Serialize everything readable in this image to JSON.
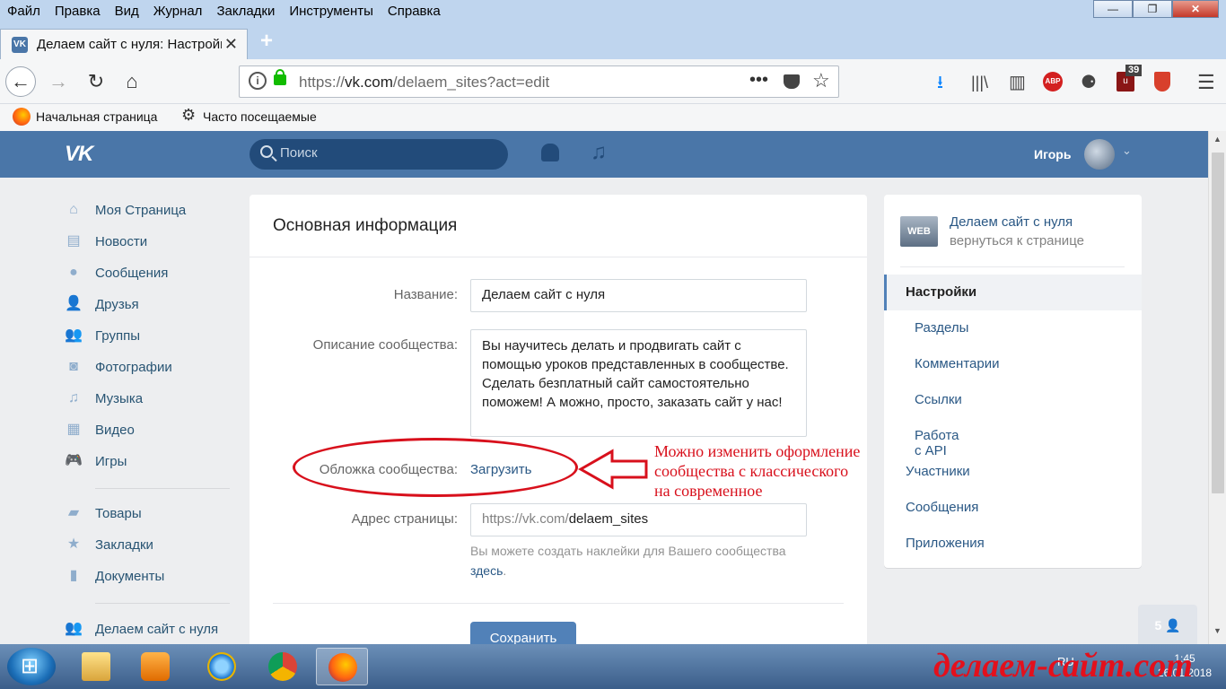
{
  "browser": {
    "menu": [
      "Файл",
      "Правка",
      "Вид",
      "Журнал",
      "Закладки",
      "Инструменты",
      "Справка"
    ],
    "window_buttons": {
      "minimize": "—",
      "maximize": "❐",
      "close": "✕"
    },
    "tab": {
      "title": "Делаем сайт с нуля: Настройки",
      "favicon": "vk-icon",
      "close": "✕"
    },
    "new_tab": "+",
    "url_prefix": "https://",
    "url_domain": "vk.com",
    "url_path": "/delaem_sites?act=edit",
    "page_actions": "•••",
    "ublock_count": "39",
    "abp_label": "ABP",
    "bookmarks": [
      "Начальная страница",
      "Часто посещаемые"
    ]
  },
  "vk_header": {
    "logo": "VK",
    "search_placeholder": "Поиск",
    "user_name": "Игорь"
  },
  "left_nav": [
    {
      "label": "Моя Страница",
      "icon": "home-icon"
    },
    {
      "label": "Новости",
      "icon": "news-icon"
    },
    {
      "label": "Сообщения",
      "icon": "messages-icon"
    },
    {
      "label": "Друзья",
      "icon": "friends-icon"
    },
    {
      "label": "Группы",
      "icon": "groups-icon"
    },
    {
      "label": "Фотографии",
      "icon": "photo-icon"
    },
    {
      "label": "Музыка",
      "icon": "music-icon"
    },
    {
      "label": "Видео",
      "icon": "video-icon"
    },
    {
      "label": "Игры",
      "icon": "games-icon"
    },
    {
      "label": "Товары",
      "icon": "bag-icon"
    },
    {
      "label": "Закладки",
      "icon": "star-icon"
    },
    {
      "label": "Документы",
      "icon": "document-icon"
    },
    {
      "label": "Делаем сайт с нуля",
      "icon": "group-icon"
    }
  ],
  "main": {
    "title": "Основная информация",
    "name_label": "Название:",
    "name_value": "Делаем сайт с нуля",
    "desc_label": "Описание сообщества:",
    "desc_value": "Вы научитесь делать и продвигать сайт с помощью уроков представленных в сообществе. Сделать безплатный сайт самостоятельно поможем! А можно, просто, заказать сайт у нас!",
    "cover_label": "Обложка сообщества:",
    "cover_link": "Загрузить",
    "address_label": "Адрес страницы:",
    "address_prefix": "https://vk.com/",
    "address_value": "delaem_sites",
    "hint_text": "Вы можете создать наклейки для Вашего сообщества",
    "hint_link": "здесь",
    "hint_end": ".",
    "save_label": "Сохранить"
  },
  "annotation": {
    "text": "Можно изменить оформление\nсообщества с классического\nна современное",
    "color": "#d8101c"
  },
  "right_menu": {
    "group_name": "Делаем сайт с нуля",
    "back_label": "вернуться к странице",
    "thumb_label": "WEB",
    "items": [
      {
        "label": "Настройки",
        "active": true,
        "sub": false
      },
      {
        "label": "Разделы",
        "active": false,
        "sub": true
      },
      {
        "label": "Комментарии",
        "active": false,
        "sub": true
      },
      {
        "label": "Ссылки",
        "active": false,
        "sub": true
      },
      {
        "label": "Работа с API",
        "active": false,
        "sub": true
      },
      {
        "label": "Участники",
        "active": false,
        "sub": false
      },
      {
        "label": "Сообщения",
        "active": false,
        "sub": false
      },
      {
        "label": "Приложения",
        "active": false,
        "sub": false
      }
    ]
  },
  "online_people": "5",
  "taskbar": {
    "tray_lang": "RU",
    "time": "1:45",
    "date": "26.01.2018"
  },
  "watermark": "делаем-сайт.com",
  "colors": {
    "vk_blue": "#4a76a8",
    "link": "#2a5885",
    "button": "#5181b8",
    "annotation_red": "#d8101c"
  }
}
